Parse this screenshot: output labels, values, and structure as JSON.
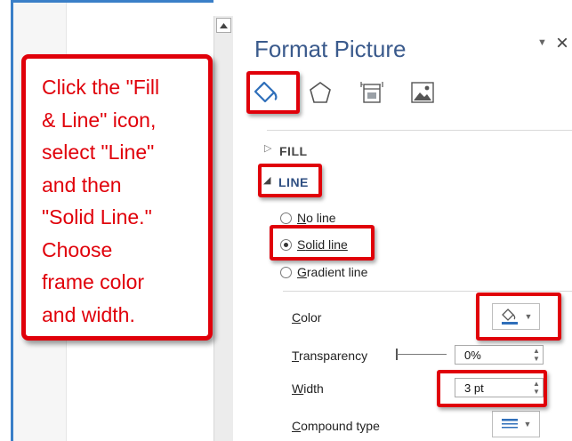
{
  "callout": {
    "text": "Click the \"Fill\n& Line\" icon,\nselect \"Line\"\nand then\n\"Solid Line.\"\nChoose\nframe color\nand width."
  },
  "panel": {
    "title": "Format Picture",
    "minimize_glyph": "▼",
    "close_glyph": "×",
    "tabs": [
      {
        "name": "Fill & Line",
        "icon": "paint-bucket-icon"
      },
      {
        "name": "Effects",
        "icon": "pentagon-icon"
      },
      {
        "name": "Layout & Properties",
        "icon": "size-properties-icon"
      },
      {
        "name": "Picture",
        "icon": "picture-icon"
      }
    ]
  },
  "sections": {
    "fill": {
      "label": "FILL",
      "arrow": "▷"
    },
    "line": {
      "label": "LINE",
      "arrow": "◢"
    }
  },
  "line_options": {
    "no_line": {
      "prefix": "",
      "access": "N",
      "rest": "o line",
      "selected": false
    },
    "solid_line": {
      "prefix": "",
      "access": "S",
      "rest": "olid line",
      "selected": true
    },
    "gradient_line": {
      "prefix": "",
      "access": "G",
      "rest": "radient line",
      "selected": false
    }
  },
  "properties": {
    "color": {
      "access": "C",
      "rest": "olor"
    },
    "transparency": {
      "access": "T",
      "rest": "ransparency",
      "value": "0%"
    },
    "width": {
      "access": "W",
      "rest": "idth",
      "value": "3 pt"
    },
    "compound": {
      "access": "C",
      "rest": "ompound type"
    }
  },
  "colors": {
    "accent_red": "#e0000a",
    "title_blue": "#3a5a8c",
    "line_blue": "#2f4f82"
  }
}
